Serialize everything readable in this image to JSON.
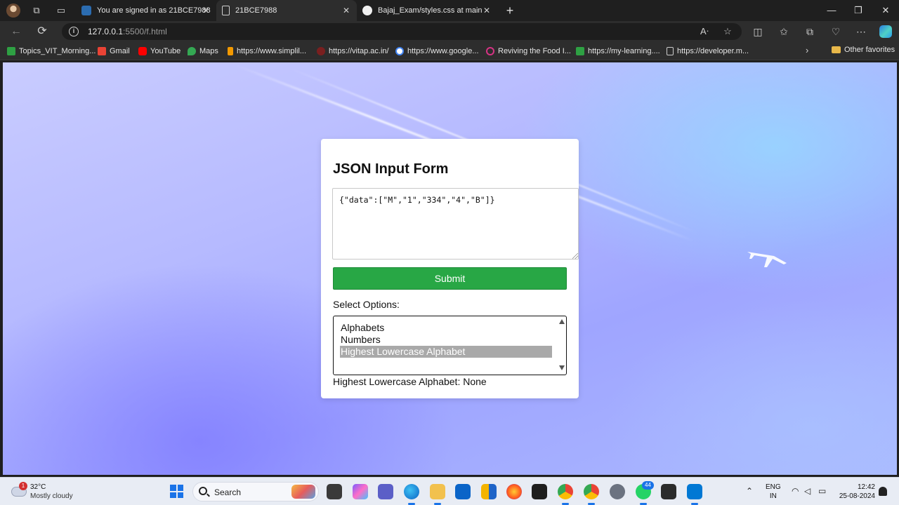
{
  "browser": {
    "tabs": [
      {
        "title": "You are signed in as 21BCE7988",
        "active": false
      },
      {
        "title": "21BCE7988",
        "active": true
      },
      {
        "title": "Bajaj_Exam/styles.css at main · PA",
        "active": false
      }
    ],
    "close_glyph": "✕",
    "new_tab_glyph": "+",
    "window_controls": {
      "minimize": "—",
      "maximize": "❐",
      "close": "✕"
    },
    "url_host": "127.0.0.1",
    "url_rest": ":5500/f.html",
    "favorites": [
      {
        "label": "Topics_VIT_Morning...",
        "color": "#2ea043"
      },
      {
        "label": "Gmail",
        "color": "#ea4335"
      },
      {
        "label": "YouTube",
        "color": "#ff0000"
      },
      {
        "label": "Maps",
        "color": "#34a853"
      },
      {
        "label": "https://www.simplil...",
        "color": "#f29900"
      },
      {
        "label": "https://vitap.ac.in/",
        "color": "#7a1f1f"
      },
      {
        "label": "https://www.google...",
        "color": "#4285f4"
      },
      {
        "label": "Reviving the Food I...",
        "color": "#d63384"
      },
      {
        "label": "https://my-learning....",
        "color": "#2ea043"
      },
      {
        "label": "https://developer.m...",
        "color": "#cccccc"
      }
    ],
    "other_favorites": "Other favorites"
  },
  "form": {
    "title": "JSON Input Form",
    "json_value": "{\"data\":[\"M\",\"1\",\"334\",\"4\",\"B\"]}",
    "submit_label": "Submit",
    "select_label": "Select Options:",
    "options": [
      {
        "label": "Alphabets",
        "selected": false
      },
      {
        "label": "Numbers",
        "selected": false
      },
      {
        "label": "Highest Lowercase Alphabet",
        "selected": true
      }
    ],
    "result_text": "Highest Lowercase Alphabet: None"
  },
  "taskbar": {
    "weather_temp": "32°C",
    "weather_desc": "Mostly cloudy",
    "weather_badge": "1",
    "search_placeholder": "Search",
    "whatsapp_badge": "44",
    "lang_top": "ENG",
    "lang_bottom": "IN",
    "time": "12:42",
    "date": "25-08-2024"
  },
  "colors": {
    "submit_green": "#28a745",
    "selected_option": "#a9a9a9",
    "taskbar_accent": "#1a73e8"
  }
}
